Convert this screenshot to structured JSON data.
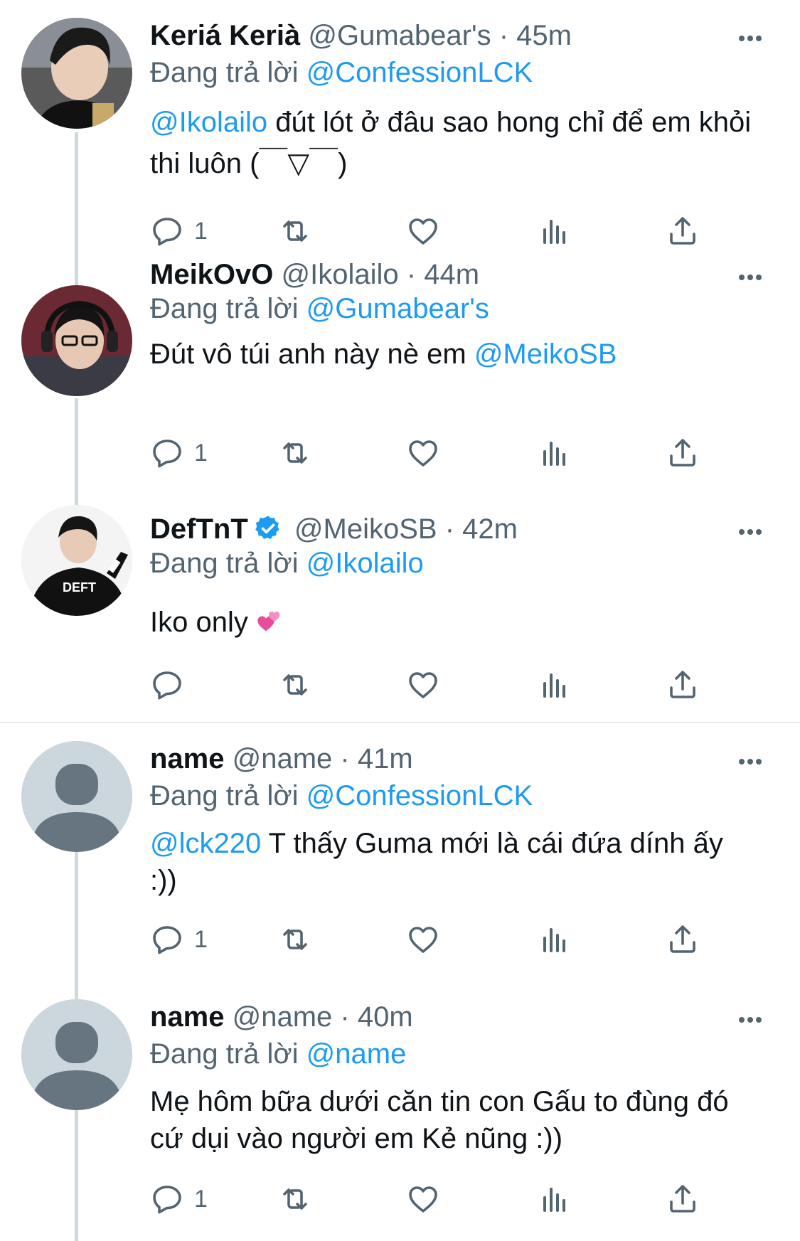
{
  "tweets": [
    {
      "name": "Keriá Kerià",
      "handle": "@Gumabear's",
      "time": "45m",
      "reply_prefix": "Đang trả lời",
      "reply_to": "@ConfessionLCK",
      "mention": "@Ikolailo",
      "text": " đút lót ở đâu sao hong chỉ để em khỏi thi luôn (￣▽￣)",
      "reply_count": "1",
      "avatar": "photo-keria-icon"
    },
    {
      "name": "MeikOvO",
      "handle": "@Ikolailo",
      "time": "44m",
      "reply_prefix": "Đang trả lời",
      "reply_to": "@Gumabear's",
      "text": "Đút vô túi anh này nè em ",
      "trailing_mention": "@MeikoSB",
      "reply_count": "1",
      "avatar": "photo-meiko-icon"
    },
    {
      "name": "DefTnT",
      "handle": "@MeikoSB",
      "time": "42m",
      "reply_prefix": "Đang trả lời",
      "reply_to": "@Ikolailo",
      "text": "Iko only",
      "jersey_text": "DEFT",
      "emoji": "two-hearts-emoji",
      "reply_count": "",
      "verified": true,
      "avatar": "photo-deft-icon"
    },
    {
      "name": "name",
      "handle": "@name",
      "time": "41m",
      "reply_prefix": "Đang trả lời",
      "reply_to": "@ConfessionLCK",
      "mention": "@lck220",
      "text": " T thấy Guma mới là cái đứa dính ấy :))",
      "reply_count": "1",
      "avatar": "default-avatar-icon"
    },
    {
      "name": "name",
      "handle": "@name",
      "time": "40m",
      "reply_prefix": "Đang trả lời",
      "reply_to": "@name",
      "text": "Mẹ hôm bữa dưới căn tin con Gấu to đùng đó cứ dụi vào người em Kẻ nũng :))",
      "reply_count": "1",
      "avatar": "default-avatar-icon"
    }
  ],
  "separator": "·",
  "colors": {
    "link": "#1d9bf0",
    "secondary": "#536471",
    "thread_line": "#cfd9de"
  }
}
